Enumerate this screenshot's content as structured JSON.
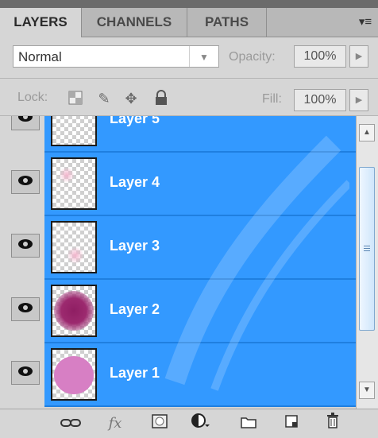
{
  "tabs": [
    {
      "label": "LAYERS",
      "active": true
    },
    {
      "label": "CHANNELS",
      "active": false
    },
    {
      "label": "PATHS",
      "active": false
    }
  ],
  "panel_menu_icon": "panel-menu-icon",
  "blend_mode": {
    "value": "Normal"
  },
  "opacity": {
    "label": "Opacity:",
    "value": "100%"
  },
  "lock": {
    "label": "Lock:"
  },
  "fill": {
    "label": "Fill:",
    "value": "100%"
  },
  "layers": [
    {
      "name": "Layer 5",
      "visible": true,
      "selected": true
    },
    {
      "name": "Layer 4",
      "visible": true,
      "selected": true
    },
    {
      "name": "Layer 3",
      "visible": true,
      "selected": true
    },
    {
      "name": "Layer 2",
      "visible": true,
      "selected": true
    },
    {
      "name": "Layer 1",
      "visible": true,
      "selected": true
    }
  ],
  "colors": {
    "selection": "#3399ff",
    "layer2_blob": "#9c2a6f",
    "layer1_blob": "#d77fc4",
    "pink_faint": "#f5c8dc"
  },
  "toolbar": {
    "fx_label": "fx"
  }
}
